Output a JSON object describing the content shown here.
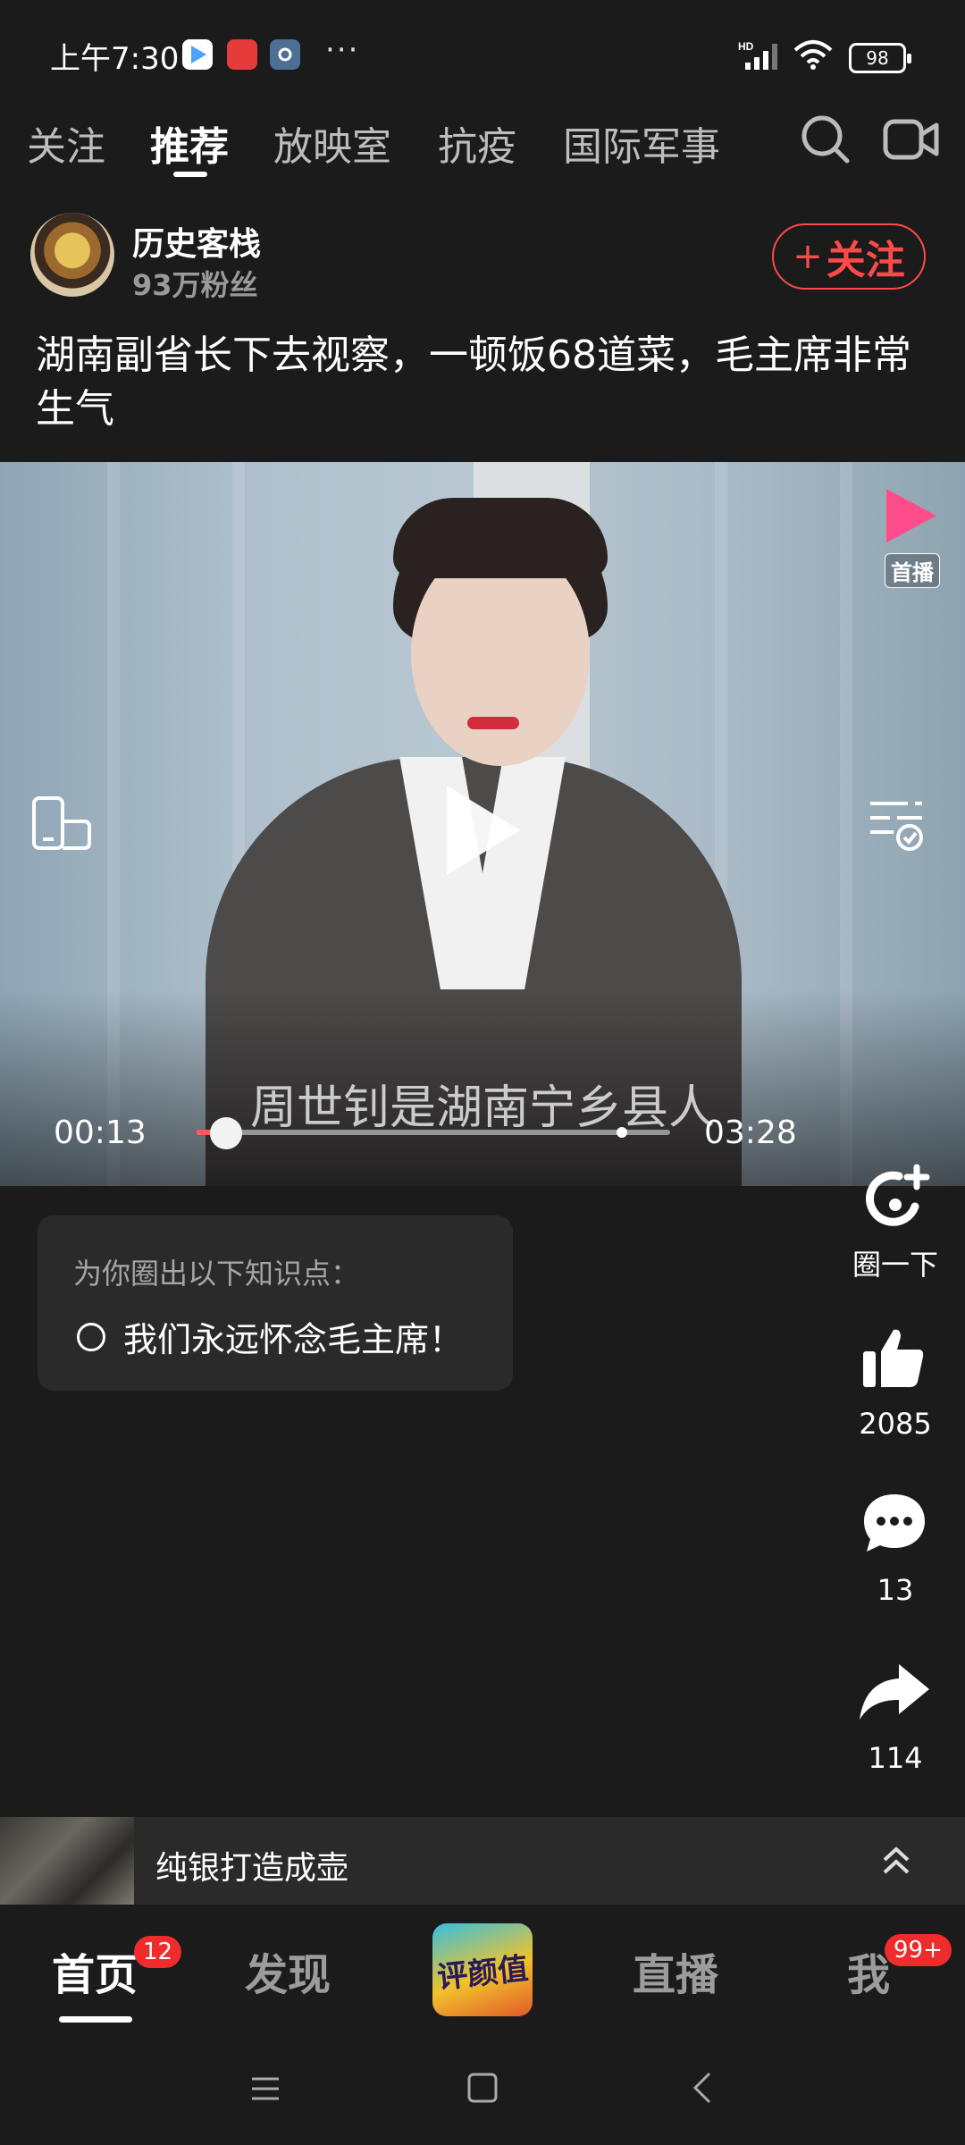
{
  "status_bar": {
    "time": "上午7:30",
    "more": "···",
    "signal": "HD",
    "battery": "98"
  },
  "tabs": [
    {
      "label": "关注"
    },
    {
      "label": "推荐"
    },
    {
      "label": "放映室"
    },
    {
      "label": "抗疫"
    },
    {
      "label": "国际军事"
    }
  ],
  "author": {
    "name": "历史客栈",
    "fans": "93万粉丝",
    "follow_plus": "+",
    "follow_label": "关注"
  },
  "video": {
    "title": "湖南副省长下去视察，一顿饭68道菜，毛主席非常生气",
    "subtitle": "周世钊是湖南宁乡县人",
    "current_time": "00:13",
    "total_time": "03:28",
    "progress": 0.063,
    "first_badge": "首播"
  },
  "knowledge": {
    "header": "为你圈出以下知识点：",
    "item": "我们永远怀念毛主席！"
  },
  "actions": {
    "circle_label": "圈一下",
    "likes": "2085",
    "comments": "13",
    "shares": "114"
  },
  "ad": {
    "text": "纯银打造成壶"
  },
  "bottom_nav": {
    "home": "首页",
    "home_badge": "12",
    "discover": "发现",
    "center_logo": "评颜值",
    "live": "直播",
    "me": "我",
    "me_badge": "99+"
  },
  "colors": {
    "accent": "#ff4a4a",
    "background": "#1b1b1b",
    "badge": "#f02b2b"
  }
}
